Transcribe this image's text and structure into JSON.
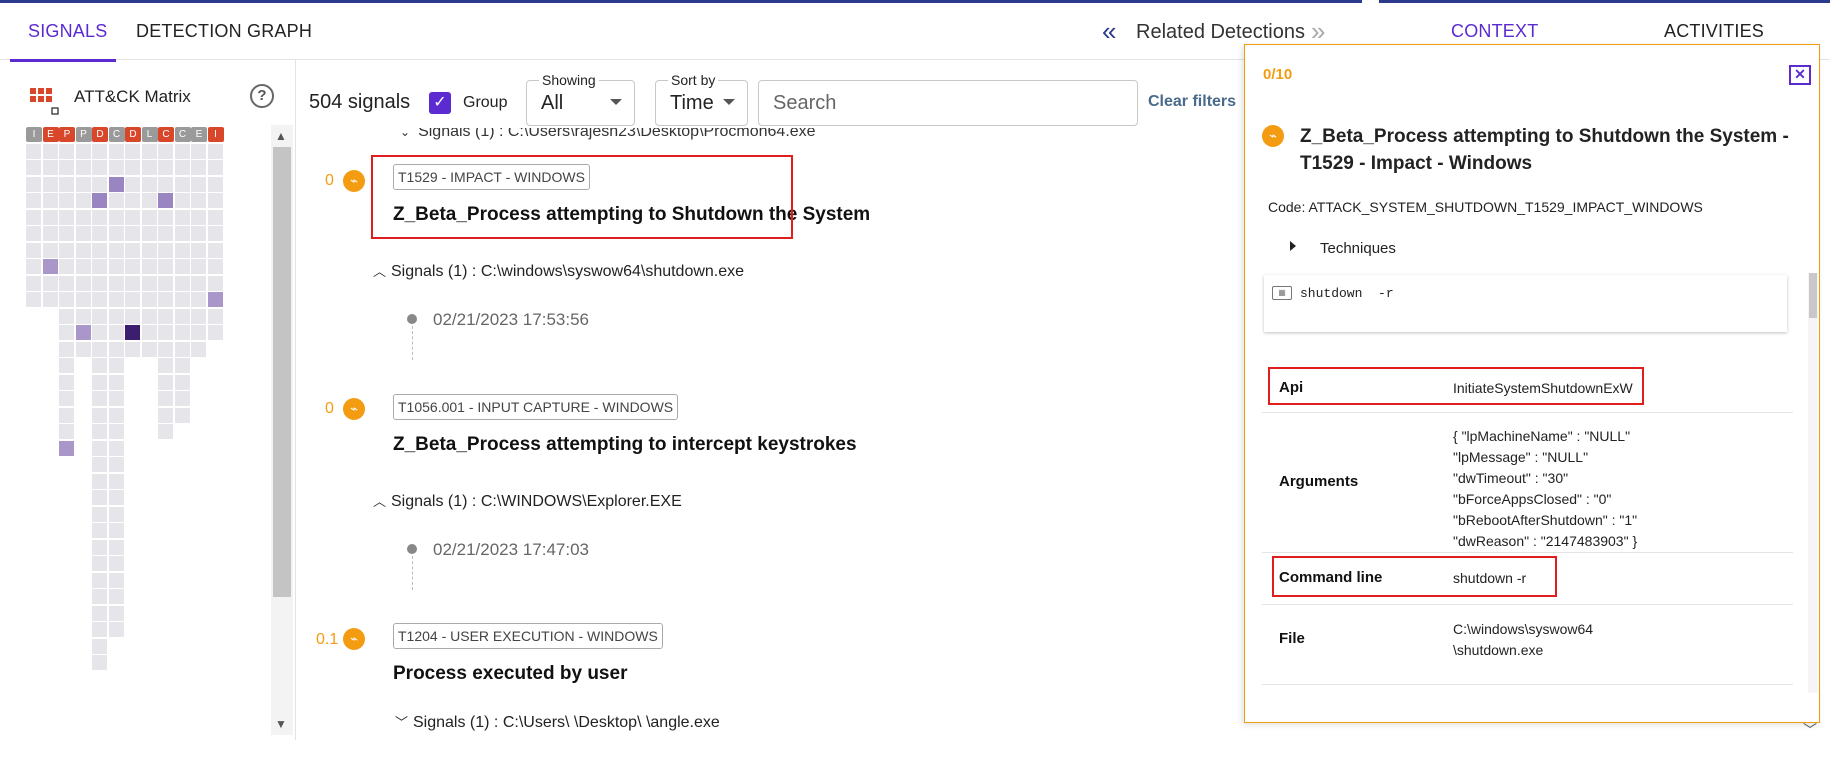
{
  "tabs": {
    "signals": "SIGNALS",
    "detection_graph": "DETECTION GRAPH"
  },
  "related": {
    "label": "Related Detections",
    "prev_icon": "«",
    "next_icon": "»"
  },
  "right_tabs": {
    "context": "CONTEXT",
    "activities": "ACTIVITIES"
  },
  "matrix": {
    "title": "ATT&CK Matrix",
    "help_icon": "?",
    "tactics": [
      "I",
      "E",
      "P",
      "P",
      "D",
      "C",
      "D",
      "L",
      "C",
      "C",
      "E",
      "I"
    ],
    "tactic_colors": [
      "#9a9a9a",
      "#d9472b",
      "#d9472b",
      "#9a9a9a",
      "#d9472b",
      "#9a9a9a",
      "#d9472b",
      "#9a9a9a",
      "#d9472b",
      "#9a9a9a",
      "#9a9a9a",
      "#d9472b"
    ],
    "column_heights": [
      10,
      10,
      13,
      13,
      13,
      13,
      13,
      13,
      13,
      13,
      13,
      12
    ],
    "column_heights_extra": [
      0,
      0,
      19,
      0,
      32,
      30,
      0,
      0,
      18,
      17,
      0,
      0
    ],
    "highlighted": [
      {
        "col": 5,
        "row": 2,
        "level": "l2"
      },
      {
        "col": 4,
        "row": 3,
        "level": "l2"
      },
      {
        "col": 8,
        "row": 3,
        "level": "l2"
      },
      {
        "col": 1,
        "row": 7,
        "level": "l1"
      },
      {
        "col": 11,
        "row": 9,
        "level": "l1"
      },
      {
        "col": 3,
        "row": 11,
        "level": "l1"
      },
      {
        "col": 6,
        "row": 11,
        "level": "l3"
      },
      {
        "col": 2,
        "row": 18,
        "level": "l1"
      }
    ]
  },
  "toolbar": {
    "signal_count": "504 signals",
    "group_label": "Group",
    "group_checked": true,
    "showing_label": "Showing",
    "showing_value": "All",
    "sort_label": "Sort by",
    "sort_value": "Time",
    "search_placeholder": "Search",
    "clear_filters": "Clear filters"
  },
  "list": {
    "truncated_row": "Signals (1) : C:\\Users\\rajesh23\\Desktop\\Procmon64.exe",
    "items": [
      {
        "score": "0",
        "tag": "T1529 - IMPACT - WINDOWS",
        "title": "Z_Beta_Process attempting to Shutdown the System",
        "signals_row": "Signals (1) : C:\\windows\\syswow64\\shutdown.exe",
        "timestamp": "02/21/2023 17:53:56"
      },
      {
        "score": "0",
        "tag": "T1056.001 - INPUT CAPTURE - WINDOWS",
        "title": "Z_Beta_Process attempting to intercept keystrokes",
        "signals_row": "Signals (1) : C:\\WINDOWS\\Explorer.EXE",
        "timestamp": "02/21/2023 17:47:03"
      },
      {
        "score": "0.1",
        "tag": "T1204 - USER EXECUTION - WINDOWS",
        "title": "Process executed by user",
        "signals_row": "Signals (1) : C:\\Users\\          \\Desktop\\         \\angle.exe"
      }
    ]
  },
  "flyout": {
    "counter": "0/10",
    "close_icon": "✕",
    "title": "Z_Beta_Process attempting to Shutdown the System - T1529 - Impact - Windows",
    "code": "Code: ATTACK_SYSTEM_SHUTDOWN_T1529_IMPACT_WINDOWS",
    "techniques_label": "Techniques",
    "command": "shutdown  -r",
    "fields": {
      "api_key": "Api",
      "api_value": "InitiateSystemShutdownExW",
      "arguments_key": "Arguments",
      "arguments_value": "{ \"lpMachineName\" : \"NULL\"\n\"lpMessage\" : \"NULL\"\n\"dwTimeout\" : \"30\"\n\"bForceAppsClosed\" : \"0\"\n\"bRebootAfterShutdown\" : \"1\"\n\"dwReason\" : \"2147483903\" }",
      "command_line_key": "Command line",
      "command_line_value": "shutdown -r",
      "file_key": "File",
      "file_value": "C:\\windows\\syswow64\n\\shutdown.exe"
    }
  },
  "colors": {
    "accent": "#5b2bd1",
    "score": "#f39c12",
    "highlight": "#e01e1e",
    "nav": "#2b3a8c"
  }
}
